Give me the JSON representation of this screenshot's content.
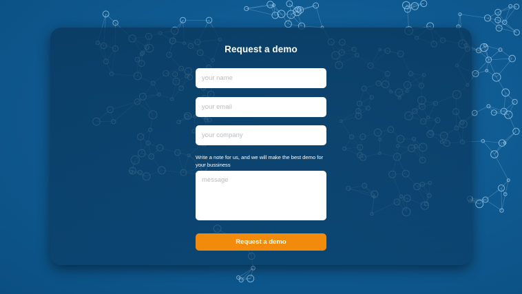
{
  "form": {
    "title": "Request a demo",
    "name_placeholder": "your name",
    "email_placeholder": "your email",
    "company_placeholder": "your company",
    "note": "Write a note for us, and we will make the best demo for your bussiness",
    "message_placeholder": "message",
    "submit_label": "Request a demo"
  },
  "colors": {
    "background": "#0e5c94",
    "card": "#0a3e66",
    "accent_button": "#f28a0c",
    "field": "#ffffff",
    "network_lines": "#7fb6dd"
  },
  "decor": {
    "background_pattern": "network-graph-world-map"
  }
}
